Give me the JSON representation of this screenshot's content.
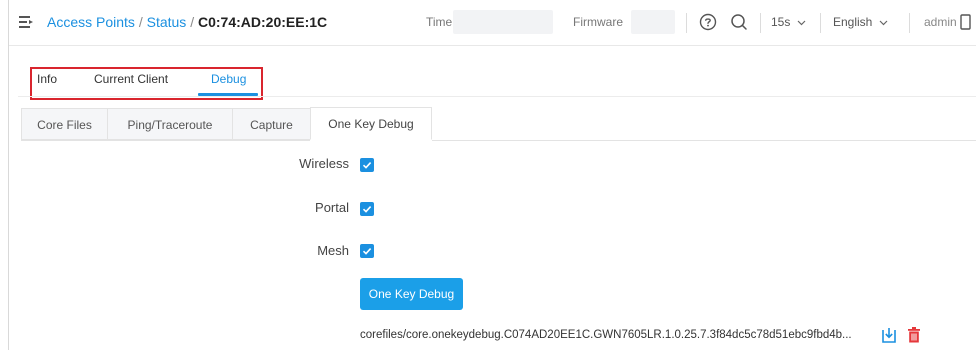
{
  "header": {
    "breadcrumb": {
      "link": "Access Points",
      "sep1": " / ",
      "status": "Status",
      "sep2": " / ",
      "current": "C0:74:AD:20:EE:1C"
    },
    "time_label": "Time",
    "firmware_label": "Firmware",
    "refresh_interval": "15s",
    "language": "English",
    "user": "admin",
    "icons": [
      "menu-collapse-icon",
      "help-icon",
      "search-icon",
      "chevron-down-icon",
      "logout-icon"
    ]
  },
  "tabs": {
    "items": [
      {
        "label": "Info",
        "active": false
      },
      {
        "label": "Current Client",
        "active": false
      },
      {
        "label": "Debug",
        "active": true
      }
    ]
  },
  "subtabs": {
    "items": [
      {
        "label": "Core Files",
        "active": false
      },
      {
        "label": "Ping/Traceroute",
        "active": false
      },
      {
        "label": "Capture",
        "active": false
      },
      {
        "label": "One Key Debug",
        "active": true
      }
    ]
  },
  "form": {
    "options": [
      {
        "label": "Wireless",
        "checked": true
      },
      {
        "label": "Portal",
        "checked": true
      },
      {
        "label": "Mesh",
        "checked": true
      }
    ],
    "button_label": "One Key Debug",
    "file_name": "corefiles/core.onekeydebug.C074AD20EE1C.GWN7605LR.1.0.25.7.3f84dc5c78d51ebc9fbd4b..."
  },
  "colors": {
    "accent": "#1b90e0",
    "highlight_border": "#d9252e",
    "delete": "#e5383b"
  }
}
